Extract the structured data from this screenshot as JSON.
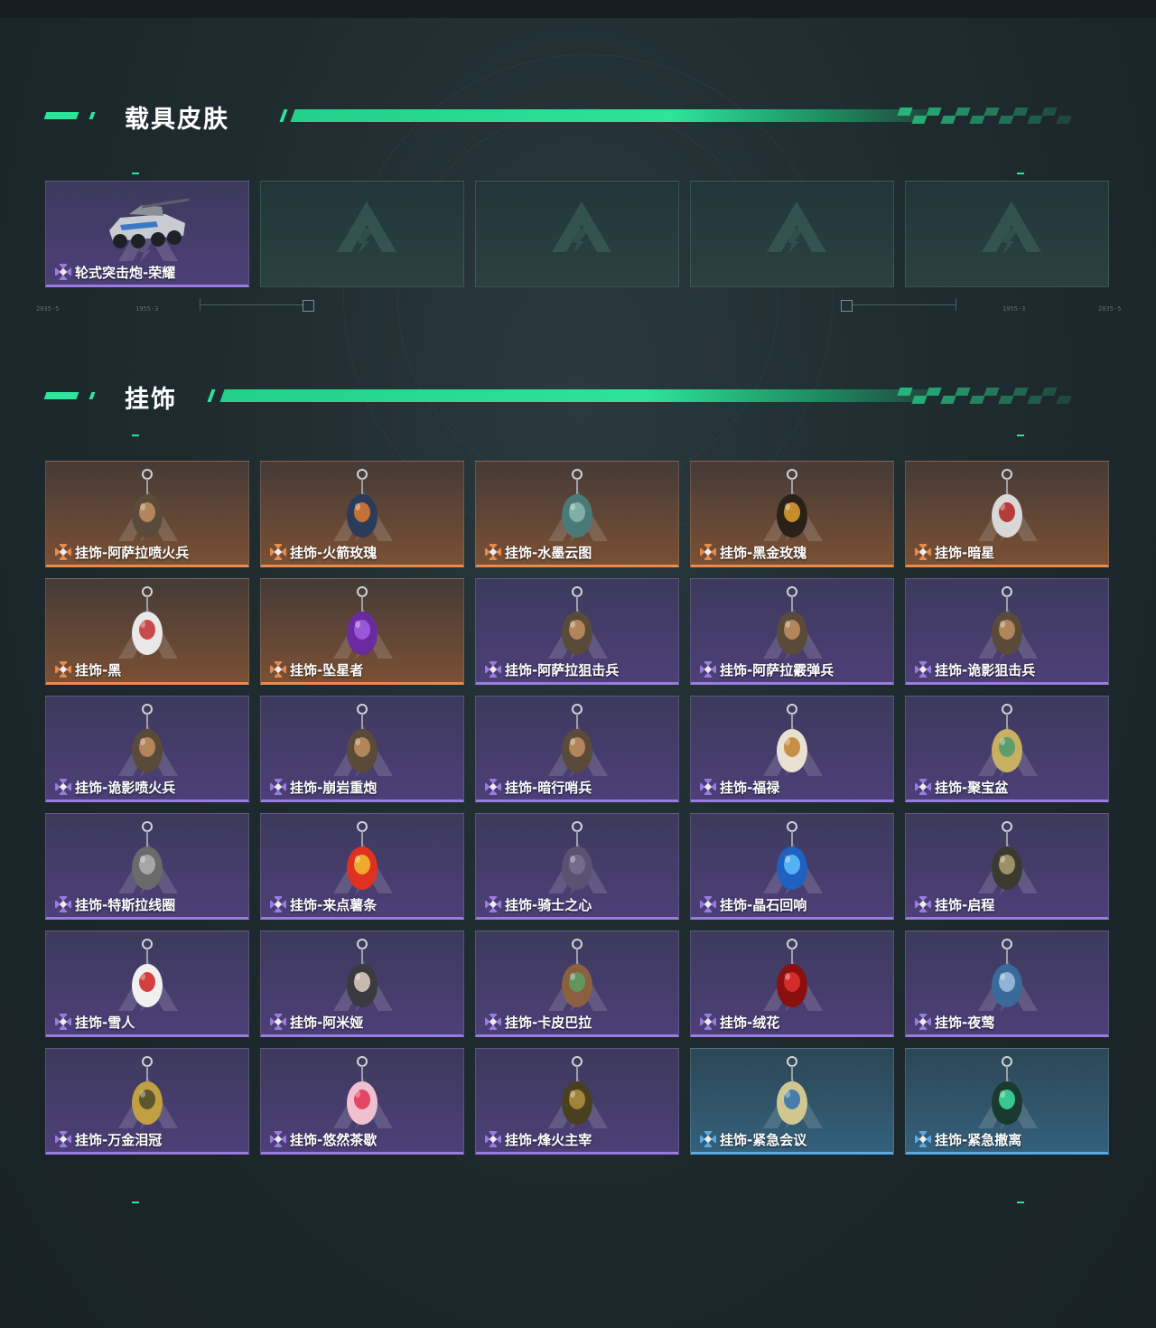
{
  "sections": {
    "vehicle": {
      "title": "载具皮肤"
    },
    "charms": {
      "title": "挂饰"
    }
  },
  "hud": {
    "left_code_1": "2035-5",
    "left_code_2": "1955-3",
    "right_code_1": "1955-3",
    "right_code_2": "2035-5"
  },
  "vehicle_cards": [
    {
      "label": "轮式突击炮-荣耀",
      "rarity": "purple",
      "icon": "armored-vehicle-icon"
    },
    {
      "label": "",
      "rarity": "empty",
      "icon": "placeholder-logo-icon"
    },
    {
      "label": "",
      "rarity": "empty",
      "icon": "placeholder-logo-icon"
    },
    {
      "label": "",
      "rarity": "empty",
      "icon": "placeholder-logo-icon"
    },
    {
      "label": "",
      "rarity": "empty",
      "icon": "placeholder-logo-icon"
    }
  ],
  "charm_cards": [
    {
      "label": "挂饰-阿萨拉喷火兵",
      "rarity": "orange",
      "icon": "figure-charm-icon"
    },
    {
      "label": "挂饰-火箭玫瑰",
      "rarity": "orange",
      "icon": "rocket-charm-icon"
    },
    {
      "label": "挂饰-水墨云图",
      "rarity": "orange",
      "icon": "cat-charm-icon"
    },
    {
      "label": "挂饰-黑金玫瑰",
      "rarity": "orange",
      "icon": "emblem-charm-icon"
    },
    {
      "label": "挂饰-暗星",
      "rarity": "orange",
      "icon": "bird-charm-icon"
    },
    {
      "label": "挂饰-黑",
      "rarity": "orange",
      "icon": "tag-charm-icon"
    },
    {
      "label": "挂饰-坠星者",
      "rarity": "orange",
      "icon": "crystal-charm-icon"
    },
    {
      "label": "挂饰-阿萨拉狙击兵",
      "rarity": "purple",
      "icon": "figure-charm-icon"
    },
    {
      "label": "挂饰-阿萨拉霰弹兵",
      "rarity": "purple",
      "icon": "figure-charm-icon"
    },
    {
      "label": "挂饰-诡影狙击兵",
      "rarity": "purple",
      "icon": "figure-charm-icon"
    },
    {
      "label": "挂饰-诡影喷火兵",
      "rarity": "purple",
      "icon": "figure-charm-icon"
    },
    {
      "label": "挂饰-崩岩重炮",
      "rarity": "purple",
      "icon": "figure-charm-icon"
    },
    {
      "label": "挂饰-暗行哨兵",
      "rarity": "purple",
      "icon": "figure-charm-icon"
    },
    {
      "label": "挂饰-福禄",
      "rarity": "purple",
      "icon": "gourd-charm-icon"
    },
    {
      "label": "挂饰-聚宝盆",
      "rarity": "purple",
      "icon": "bowl-charm-icon"
    },
    {
      "label": "挂饰-特斯拉线圈",
      "rarity": "purple",
      "icon": "coil-charm-icon"
    },
    {
      "label": "挂饰-来点薯条",
      "rarity": "purple",
      "icon": "fries-charm-icon"
    },
    {
      "label": "挂饰-骑士之心",
      "rarity": "purple",
      "icon": "heart-charm-icon"
    },
    {
      "label": "挂饰-晶石回响",
      "rarity": "purple",
      "icon": "gem-charm-icon"
    },
    {
      "label": "挂饰-启程",
      "rarity": "purple",
      "icon": "badge-charm-icon"
    },
    {
      "label": "挂饰-雪人",
      "rarity": "purple",
      "icon": "snowman-charm-icon"
    },
    {
      "label": "挂饰-阿米娅",
      "rarity": "purple",
      "icon": "rabbit-charm-icon"
    },
    {
      "label": "挂饰-卡皮巴拉",
      "rarity": "purple",
      "icon": "capybara-charm-icon"
    },
    {
      "label": "挂饰-绒花",
      "rarity": "purple",
      "icon": "flower-charm-icon"
    },
    {
      "label": "挂饰-夜莺",
      "rarity": "purple",
      "icon": "nightingale-charm-icon"
    },
    {
      "label": "挂饰-万金泪冠",
      "rarity": "purple",
      "icon": "burger-charm-icon"
    },
    {
      "label": "挂饰-悠然茶歇",
      "rarity": "purple",
      "icon": "cupcake-charm-icon"
    },
    {
      "label": "挂饰-烽火主宰",
      "rarity": "purple",
      "icon": "triangle-charm-icon"
    },
    {
      "label": "挂饰-紧急会议",
      "rarity": "blue",
      "icon": "trophy-charm-icon"
    },
    {
      "label": "挂饰-紧急撤离",
      "rarity": "blue",
      "icon": "skull-charm-icon"
    }
  ],
  "colors": {
    "accent": "#2ee39a",
    "purple": "#9c7be0",
    "orange": "#e88b4a",
    "blue": "#5ca8e0"
  }
}
